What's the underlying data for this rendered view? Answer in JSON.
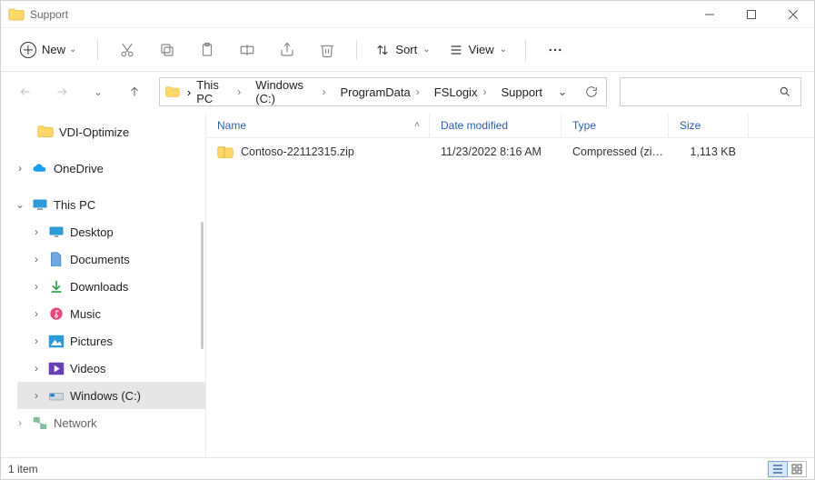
{
  "window": {
    "title": "Support"
  },
  "toolbar": {
    "new_label": "New",
    "sort_label": "Sort",
    "view_label": "View"
  },
  "breadcrumbs": {
    "b0": "This PC",
    "b1": "Windows (C:)",
    "b2": "ProgramData",
    "b3": "FSLogix",
    "b4": "Support"
  },
  "columns": {
    "name": "Name",
    "date": "Date modified",
    "type": "Type",
    "size": "Size"
  },
  "files": [
    {
      "name": "Contoso-22112315.zip",
      "date": "11/23/2022 8:16 AM",
      "type": "Compressed (zipp...",
      "size": "1,113 KB"
    }
  ],
  "nav": {
    "quick0": "VDI-Optimize",
    "onedrive": "OneDrive",
    "thispc": "This PC",
    "desktop": "Desktop",
    "documents": "Documents",
    "downloads": "Downloads",
    "music": "Music",
    "pictures": "Pictures",
    "videos": "Videos",
    "windowsc": "Windows (C:)",
    "network": "Network"
  },
  "status": {
    "item_count": "1 item"
  }
}
